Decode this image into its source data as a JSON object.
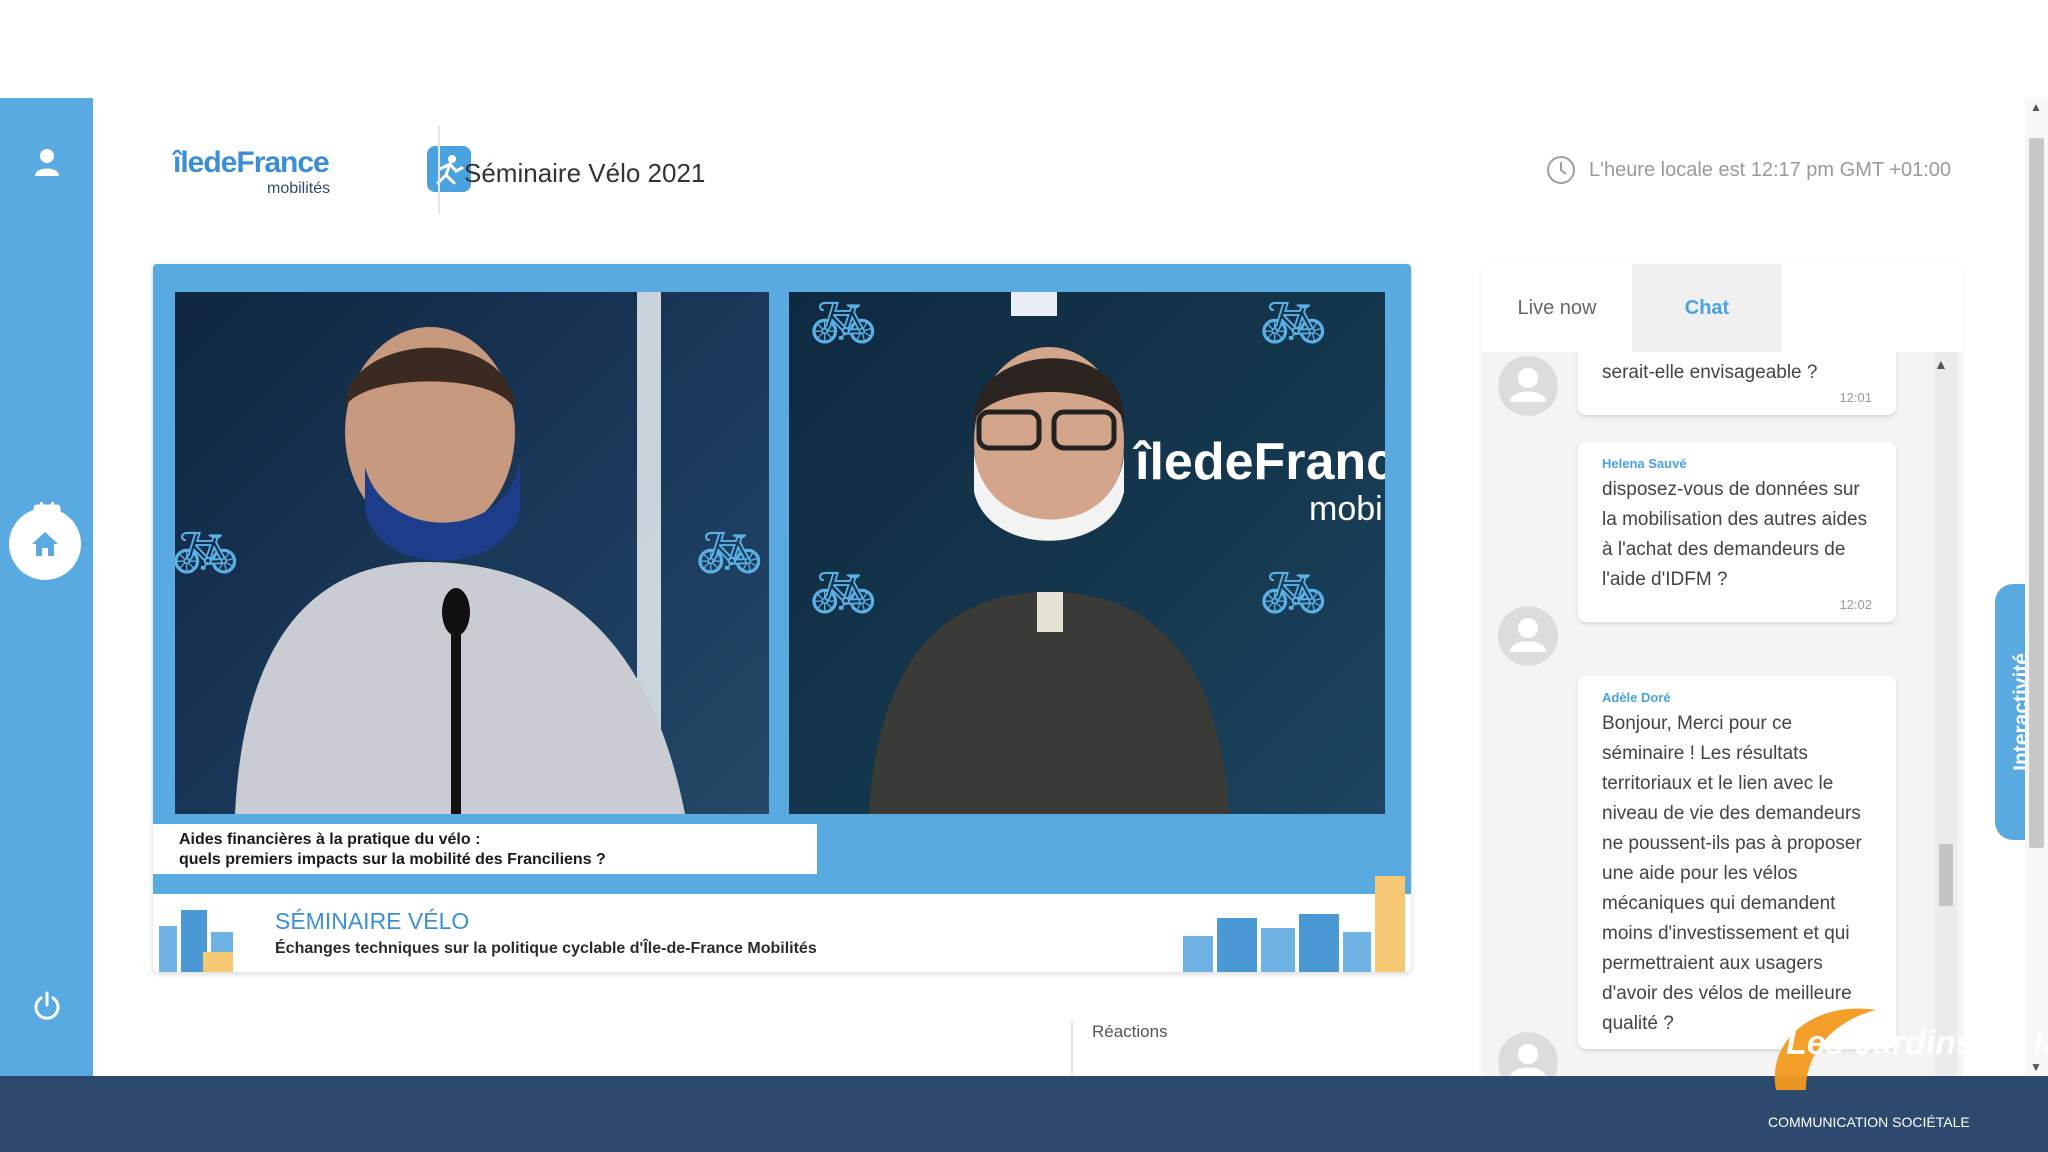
{
  "header": {
    "logo_brand": "îledeFrance",
    "logo_sub": "mobilités",
    "title": "Séminaire Vélo 2021",
    "local_time": "L'heure locale est 12:17 pm GMT +01:00"
  },
  "sidebar": {
    "items": [
      {
        "icon": "user-icon"
      },
      {
        "icon": "home-icon"
      },
      {
        "icon": "calendar-icon"
      },
      {
        "icon": "power-icon"
      }
    ]
  },
  "video": {
    "brand_panel": "îledeFranc",
    "brand_panel_sub": "mobi",
    "caption_line1": "Aides financières à la pratique du vélo :",
    "caption_line2": "quels premiers impacts sur la mobilité des Franciliens ?",
    "banner_title": "SÉMINAIRE VÉLO",
    "banner_sub": "Échanges techniques sur la politique cyclable d'Île-de-France Mobilités"
  },
  "reactions_label": "Réactions",
  "chat": {
    "tabs": [
      "Live now",
      "Chat"
    ],
    "active_tab": "Chat",
    "messages": [
      {
        "author": "",
        "text": "serait-elle envisageable ?",
        "time": "12:01"
      },
      {
        "author": "Helena Sauvé",
        "text": "disposez-vous de données sur la mobilisation des autres aides à l'achat des demandeurs de l'aide d'IDFM ?",
        "time": "12:02"
      },
      {
        "author": "Adèle Doré",
        "text": "Bonjour, Merci pour ce séminaire ! Les résultats territoriaux et le lien avec le niveau de vie des demandeurs ne poussent-ils pas à proposer une aide pour les vélos mécaniques qui demandent moins d'investissement et qui permettraient aux usagers d'avoir des vélos de meilleure qualité ?",
        "time": ""
      }
    ]
  },
  "interactivite_label": "Interactivité",
  "watermark": {
    "title": "Les Jardins de la Cité",
    "sub": "COMMUNICATION SOCIÉTALE"
  },
  "colors": {
    "accent": "#5aaae2",
    "bottom_bar": "#2d4a6e",
    "chat_author": "#4aa3df"
  }
}
